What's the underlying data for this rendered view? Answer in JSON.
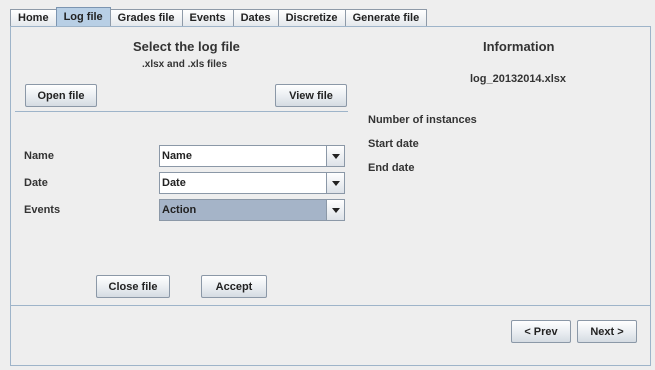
{
  "tabs": [
    "Home",
    "Log file",
    "Grades file",
    "Events",
    "Dates",
    "Discretize",
    "Generate file"
  ],
  "selected_tab": "Log file",
  "left": {
    "title": "Select the log file",
    "subtitle": ".xlsx and .xls files",
    "open_button": "Open file",
    "view_button": "View file"
  },
  "fields": [
    {
      "label": "Name",
      "value": "Name"
    },
    {
      "label": "Date",
      "value": "Date"
    },
    {
      "label": "Events",
      "value": "Action"
    }
  ],
  "actions": {
    "close_button": "Close file",
    "accept_button": "Accept"
  },
  "info": {
    "title": "Information",
    "filename": "log_20132014.xlsx",
    "instances_label": "Number of instances",
    "start_label": "Start date",
    "end_label": "End date"
  },
  "nav": {
    "prev_button": "< Prev",
    "next_button": "Next >"
  },
  "colors": {
    "selected_tab": "#b8cfe5",
    "active_combo": "#a5b4c8",
    "separator": "#9eb4c9"
  }
}
